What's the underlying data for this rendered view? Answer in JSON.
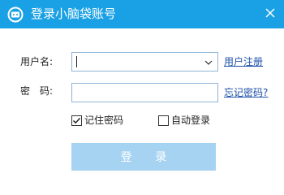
{
  "window": {
    "title": "登录小脑袋账号",
    "app_icon": "chat-bubble-logo-icon",
    "close_icon": "close-icon",
    "title_color": "#1aa1e5"
  },
  "form": {
    "username_label": "用户名:",
    "username_value": "",
    "password_label": "密　码:",
    "password_value": "",
    "register_link": "用户注册",
    "forgot_link": "忘记密码?",
    "remember_label": "记住密码",
    "remember_checked": true,
    "auto_login_label": "自动登录",
    "auto_login_checked": false,
    "login_button": "登 录"
  },
  "colors": {
    "accent": "#1aa1e5",
    "button_bg": "#a7d3f2",
    "link": "#1b4fa8"
  }
}
